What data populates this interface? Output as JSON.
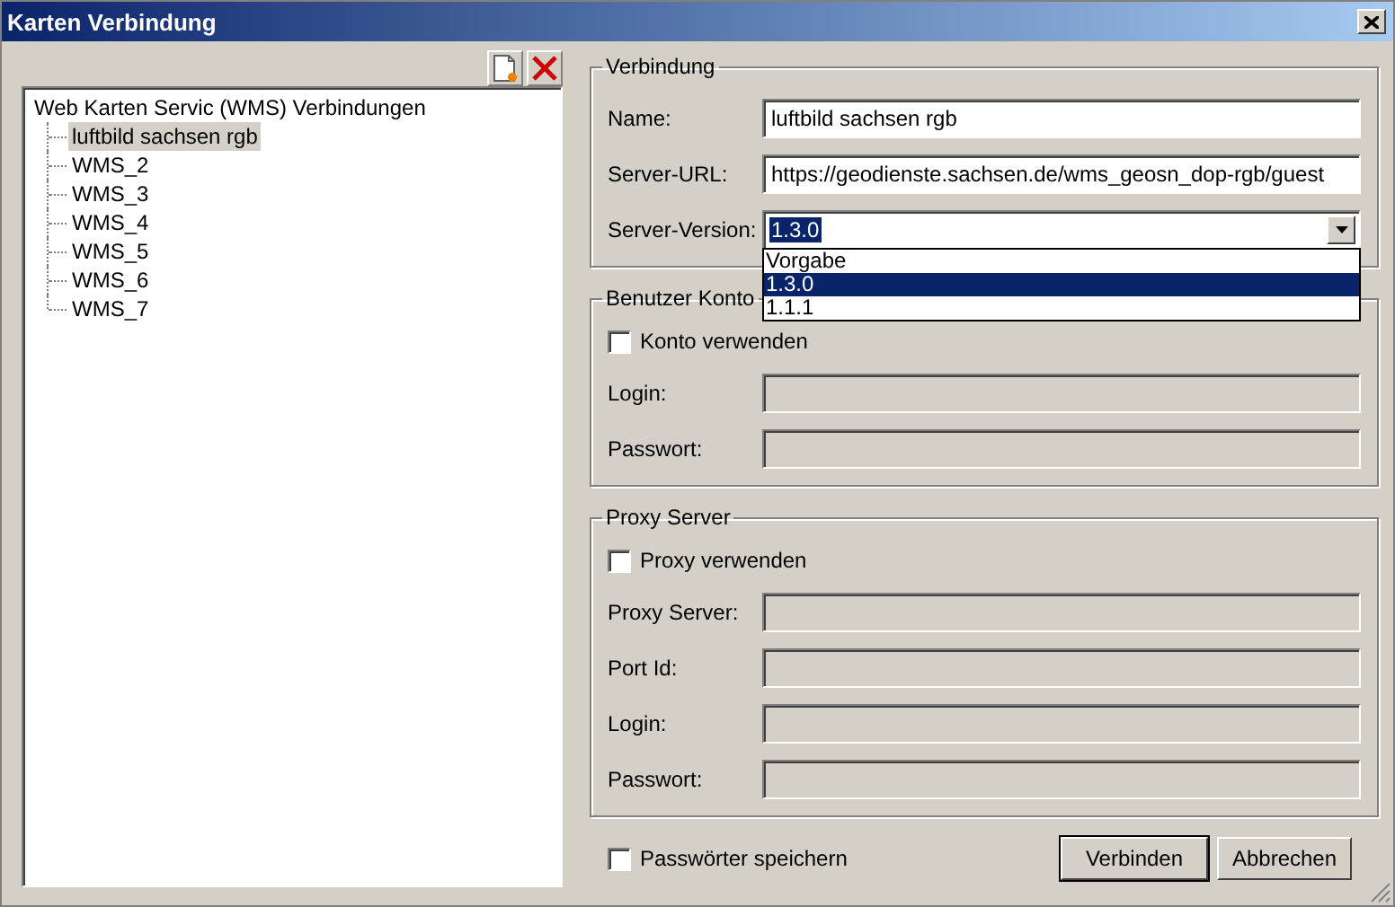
{
  "window": {
    "title": "Karten Verbindung"
  },
  "tree": {
    "label": "Web Karten Servic (WMS) Verbindungen",
    "children": [
      {
        "label": "luftbild sachsen rgb",
        "selected": true
      },
      {
        "label": "WMS_2",
        "selected": false
      },
      {
        "label": "WMS_3",
        "selected": false
      },
      {
        "label": "WMS_4",
        "selected": false
      },
      {
        "label": "WMS_5",
        "selected": false
      },
      {
        "label": "WMS_6",
        "selected": false
      },
      {
        "label": "WMS_7",
        "selected": false
      }
    ]
  },
  "groups": [
    {
      "title": "Verbindung",
      "rows": [
        {
          "kind": "text",
          "label": "Name:",
          "value": "luftbild sachsen rgb",
          "disabled": false
        },
        {
          "kind": "text",
          "label": "Server-URL:",
          "value": "https://geodienste.sachsen.de/wms_geosn_dop-rgb/guest",
          "disabled": false
        },
        {
          "kind": "select",
          "label": "Server-Version:",
          "value": "1.3.0",
          "expanded": true,
          "options": [
            {
              "label": "Vorgabe",
              "selected": false
            },
            {
              "label": "1.3.0",
              "selected": true
            },
            {
              "label": "1.1.1",
              "selected": false
            }
          ]
        }
      ]
    },
    {
      "title": "Benutzer Konto",
      "rows": [
        {
          "kind": "checkbox",
          "label": "Konto verwenden",
          "checked": false
        },
        {
          "kind": "text",
          "label": "Login:",
          "disabled": true
        },
        {
          "kind": "text",
          "label": "Passwort:",
          "disabled": true
        }
      ]
    },
    {
      "title": "Proxy Server",
      "rows": [
        {
          "kind": "checkbox",
          "label": "Proxy verwenden",
          "checked": false
        },
        {
          "kind": "text",
          "label": "Proxy Server:",
          "disabled": true
        },
        {
          "kind": "text",
          "label": "Port Id:",
          "disabled": true
        },
        {
          "kind": "text",
          "label": "Login:",
          "disabled": true
        },
        {
          "kind": "text",
          "label": "Passwort:",
          "disabled": true
        }
      ]
    }
  ],
  "save_passwords": {
    "label": "Passwörter speichern",
    "checked": false
  },
  "buttons": [
    {
      "label": "Verbinden",
      "default": true
    },
    {
      "label": "Abbrechen",
      "default": false
    }
  ]
}
